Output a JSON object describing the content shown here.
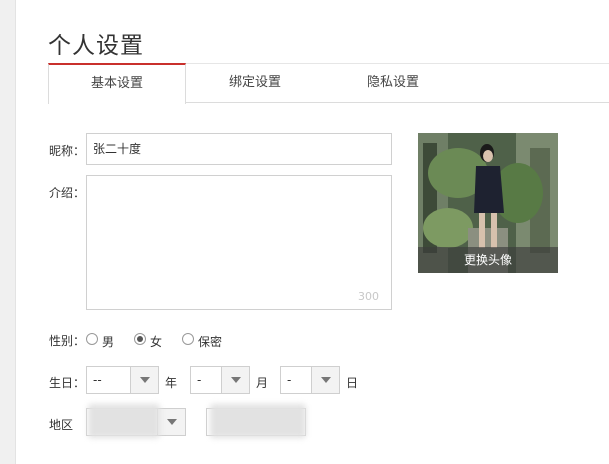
{
  "page": {
    "title": "个人设置"
  },
  "tabs": [
    {
      "label": "基本设置",
      "active": true
    },
    {
      "label": "绑定设置",
      "active": false
    },
    {
      "label": "隐私设置",
      "active": false
    }
  ],
  "form": {
    "nickname_label": "昵称：",
    "nickname_value": "张二十度",
    "intro_label": "介绍：",
    "intro_value": "",
    "intro_max": "300",
    "gender_label": "性别：",
    "gender_options": [
      "男",
      "女",
      "保密"
    ],
    "gender_selected": "女",
    "birthday_label": "生日：",
    "birthday": {
      "year": "--",
      "year_unit": "年",
      "month": "-",
      "month_unit": "月",
      "day": "-",
      "day_unit": "日"
    },
    "region_label": "地区"
  },
  "avatar": {
    "change_label": "更换头像"
  },
  "colors": {
    "accent": "#c9302c",
    "border": "#d0d0d0"
  },
  "icons": [
    "chevron-down-icon",
    "radio-icon"
  ]
}
